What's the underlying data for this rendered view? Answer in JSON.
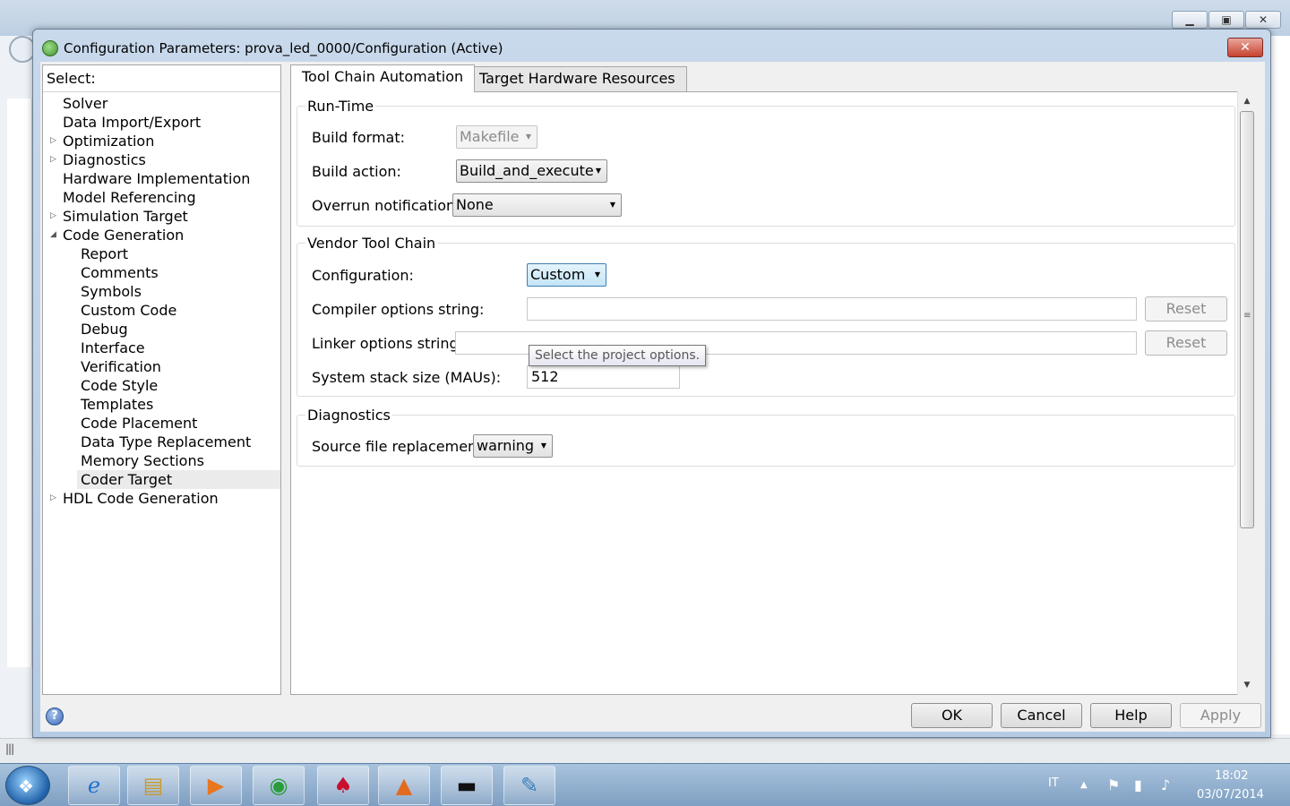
{
  "dialog": {
    "title": "Configuration Parameters: prova_led_0000/Configuration (Active)",
    "close_glyph": "✕"
  },
  "background": {
    "minimize_glyph": "▁",
    "maximize_glyph": "▣",
    "close_glyph": "✕",
    "status_glyph": "|||"
  },
  "tree": {
    "header": "Select:",
    "items": [
      {
        "label": "Solver"
      },
      {
        "label": "Data Import/Export"
      },
      {
        "label": "Optimization"
      },
      {
        "label": "Diagnostics"
      },
      {
        "label": "Hardware Implementation"
      },
      {
        "label": "Model Referencing"
      },
      {
        "label": "Simulation Target"
      },
      {
        "label": "Code Generation"
      },
      {
        "label": "Report"
      },
      {
        "label": "Comments"
      },
      {
        "label": "Symbols"
      },
      {
        "label": "Custom Code"
      },
      {
        "label": "Debug"
      },
      {
        "label": "Interface"
      },
      {
        "label": "Verification"
      },
      {
        "label": "Code Style"
      },
      {
        "label": "Templates"
      },
      {
        "label": "Code Placement"
      },
      {
        "label": "Data Type Replacement"
      },
      {
        "label": "Memory Sections"
      },
      {
        "label": "Coder Target"
      },
      {
        "label": "HDL Code Generation"
      }
    ],
    "collapsed_glyph": "▷",
    "expanded_glyph": "◢"
  },
  "tabs": [
    {
      "label": "Tool Chain Automation"
    },
    {
      "label": "Target Hardware Resources"
    }
  ],
  "runtime": {
    "title": "Run-Time",
    "build_format_label": "Build format:",
    "build_format_value": "Makefile",
    "build_action_label": "Build action:",
    "build_action_value": "Build_and_execute",
    "overrun_label": "Overrun notification:",
    "overrun_value": "None"
  },
  "vendor": {
    "title": "Vendor Tool Chain",
    "configuration_label": "Configuration:",
    "configuration_value": "Custom",
    "tooltip": "Select the project options.",
    "compiler_label": "Compiler options string:",
    "compiler_value": "",
    "linker_label": "Linker options string:",
    "linker_value": "",
    "reset_label": "Reset",
    "stack_label": "System stack size (MAUs):",
    "stack_value": "512"
  },
  "diagnostics": {
    "title": "Diagnostics",
    "source_label": "Source file replacement:",
    "source_value": "warning"
  },
  "combo_arrow": "▼",
  "scroll": {
    "up_glyph": "▲",
    "down_glyph": "▼",
    "grip_glyph": "≡"
  },
  "buttons": {
    "ok": "OK",
    "cancel": "Cancel",
    "help": "Help",
    "apply": "Apply",
    "help_icon": "?"
  },
  "taskbar": {
    "start_glyph": "❖",
    "apps": [
      {
        "name": "internet-explorer",
        "glyph": "ℯ"
      },
      {
        "name": "file-explorer",
        "glyph": "▤"
      },
      {
        "name": "media-player",
        "glyph": "▶"
      },
      {
        "name": "chrome",
        "glyph": "◉"
      },
      {
        "name": "acrobat",
        "glyph": "♠"
      },
      {
        "name": "matlab",
        "glyph": "▲"
      },
      {
        "name": "command-prompt",
        "glyph": "▬"
      },
      {
        "name": "paint",
        "glyph": "✎"
      }
    ],
    "language": "IT",
    "tray_arrow": "▲",
    "flag_glyph": "⚑",
    "signal_glyph": "▮",
    "volume_glyph": "♪",
    "time": "18:02",
    "date": "03/07/2014"
  }
}
